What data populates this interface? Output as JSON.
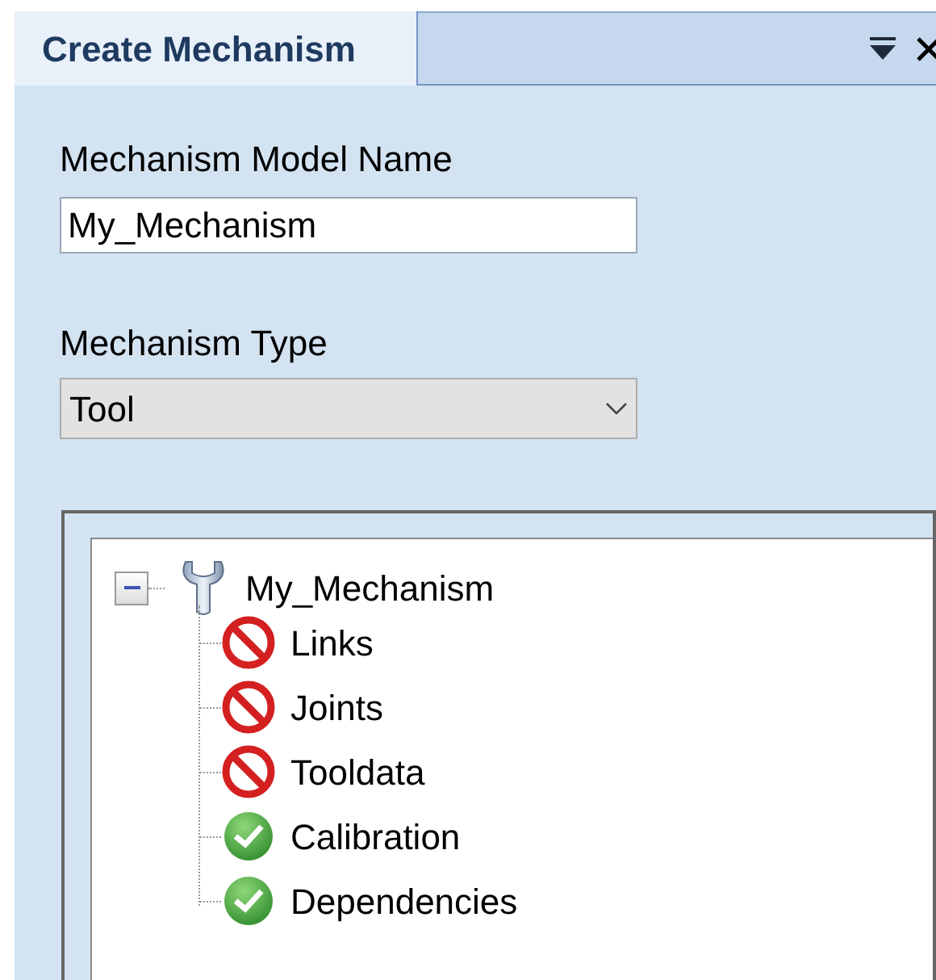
{
  "panel_tab": {
    "label": "Create Mechanism",
    "selected": true
  },
  "name_field": {
    "label": "Mechanism Model Name",
    "value": "My_Mechanism"
  },
  "type_field": {
    "label": "Mechanism Type",
    "value": "Tool"
  },
  "tree": {
    "label": "My_Mechanism",
    "expanded": true,
    "children": [
      {
        "label": "Links",
        "kind": "error"
      },
      {
        "label": "Joints",
        "kind": "error"
      },
      {
        "label": "Tooldata",
        "kind": "error"
      },
      {
        "label": "Calibration",
        "kind": "ok"
      },
      {
        "label": "Dependencies",
        "kind": "ok"
      }
    ]
  }
}
